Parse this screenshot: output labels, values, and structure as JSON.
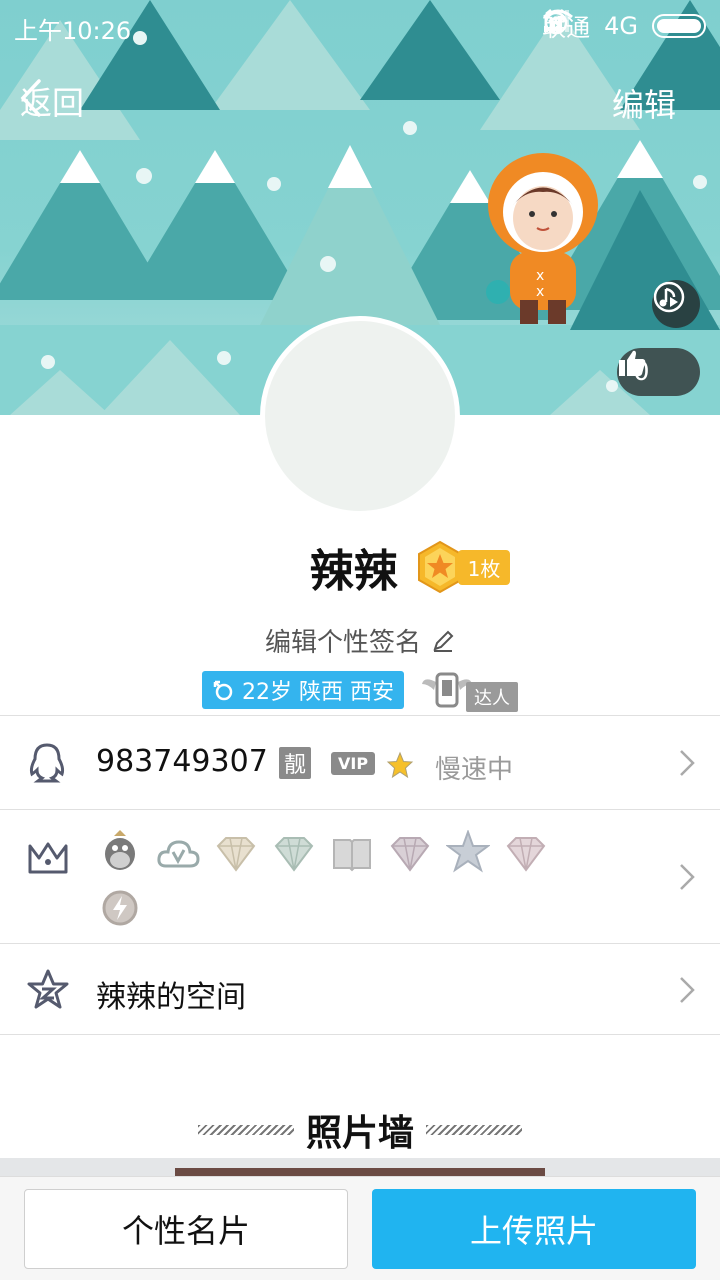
{
  "status_bar": {
    "time": "上午10:26",
    "carrier": "联通",
    "network": "4G"
  },
  "nav": {
    "back_label": "返回",
    "edit_label": "编辑"
  },
  "banner": {
    "like_count": "0"
  },
  "profile": {
    "name": "辣辣",
    "medal_count": "1枚",
    "signature_placeholder": "编辑个性签名",
    "info_tag": "22岁 陕西 西安",
    "daren_label": "达人"
  },
  "qq_row": {
    "qq_number": "983749307",
    "liang_label": "靓",
    "vip_label": "VIP",
    "speed_status": "慢速中"
  },
  "badges_row": {
    "icons": [
      "qq-penguin-icon",
      "cloud-v-icon",
      "diamond-gold-icon",
      "diamond-green-icon",
      "book-icon",
      "diamond-purple-icon",
      "star-icon",
      "diamond-pink-icon",
      "lightning-icon"
    ]
  },
  "qzone_row": {
    "label": "辣辣的空间"
  },
  "photo_wall": {
    "title": "照片墙"
  },
  "bottom_bar": {
    "card_label": "个性名片",
    "upload_label": "上传照片"
  },
  "colors": {
    "accent_blue": "#20b4f0",
    "tag_blue": "#34b4ee",
    "medal_gold": "#f6b82a"
  }
}
